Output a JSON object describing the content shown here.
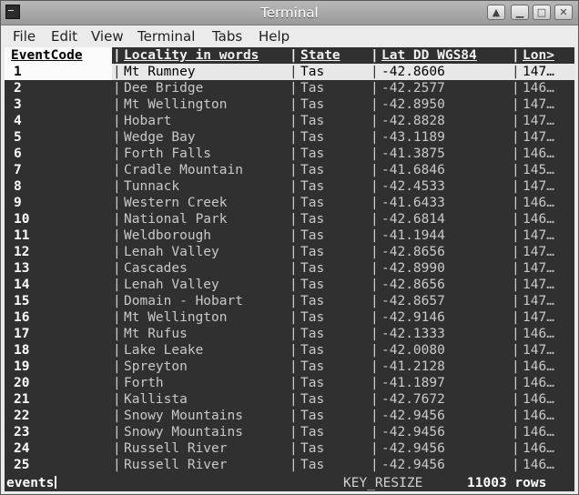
{
  "window": {
    "title": "Terminal"
  },
  "menu": [
    "File",
    "Edit",
    "View",
    "Terminal",
    "Tabs",
    "Help"
  ],
  "table": {
    "headers": [
      "EventCode",
      "Locality in words",
      "State",
      "Lat DD WGS84",
      "Lon>"
    ],
    "rows": [
      [
        "1",
        "Mt Rumney",
        "Tas",
        "-42.8606",
        "147…"
      ],
      [
        "2",
        "Dee Bridge",
        "Tas",
        "-42.2577",
        "146…"
      ],
      [
        "3",
        "Mt Wellington",
        "Tas",
        "-42.8950",
        "147…"
      ],
      [
        "4",
        "Hobart",
        "Tas",
        "-42.8828",
        "147…"
      ],
      [
        "5",
        "Wedge Bay",
        "Tas",
        "-43.1189",
        "147…"
      ],
      [
        "6",
        "Forth Falls",
        "Tas",
        "-41.3875",
        "146…"
      ],
      [
        "7",
        "Cradle Mountain",
        "Tas",
        "-41.6846",
        "145…"
      ],
      [
        "8",
        "Tunnack",
        "Tas",
        "-42.4533",
        "147…"
      ],
      [
        "9",
        "Western Creek",
        "Tas",
        "-41.6433",
        "146…"
      ],
      [
        "10",
        "National Park",
        "Tas",
        "-42.6814",
        "146…"
      ],
      [
        "11",
        "Weldborough",
        "Tas",
        "-41.1944",
        "147…"
      ],
      [
        "12",
        "Lenah Valley",
        "Tas",
        "-42.8656",
        "147…"
      ],
      [
        "13",
        "Cascades",
        "Tas",
        "-42.8990",
        "147…"
      ],
      [
        "14",
        "Lenah Valley",
        "Tas",
        "-42.8656",
        "147…"
      ],
      [
        "15",
        "Domain - Hobart",
        "Tas",
        "-42.8657",
        "147…"
      ],
      [
        "16",
        "Mt Wellington",
        "Tas",
        "-42.9146",
        "147…"
      ],
      [
        "17",
        "Mt Rufus",
        "Tas",
        "-42.1333",
        "146…"
      ],
      [
        "18",
        "Lake Leake",
        "Tas",
        "-42.0080",
        "147…"
      ],
      [
        "19",
        "Spreyton",
        "Tas",
        "-41.2128",
        "146…"
      ],
      [
        "20",
        "Forth",
        "Tas",
        "-41.1897",
        "146…"
      ],
      [
        "21",
        "Kallista",
        "Tas",
        "-42.7672",
        "146…"
      ],
      [
        "22",
        "Snowy Mountains",
        "Tas",
        "-42.9456",
        "146…"
      ],
      [
        "23",
        "Snowy Mountains",
        "Tas",
        "-42.9456",
        "146…"
      ],
      [
        "24",
        "Russell River",
        "Tas",
        "-42.9456",
        "146…"
      ],
      [
        "25",
        "Russell River",
        "Tas",
        "-42.9456",
        "146…"
      ]
    ]
  },
  "status": {
    "table_name": "events",
    "event": "KEY_RESIZE",
    "row_count": "11003 rows"
  }
}
